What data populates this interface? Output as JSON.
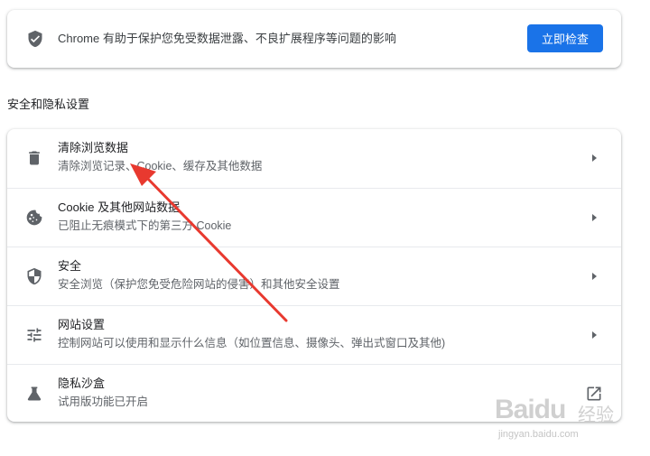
{
  "safety_check": {
    "icon": "shield-check-icon",
    "message": "Chrome 有助于保护您免受数据泄露、不良扩展程序等问题的影响",
    "button_label": "立即检查"
  },
  "privacy_section": {
    "title": "安全和隐私设置",
    "items": [
      {
        "icon": "trash-icon",
        "title": "清除浏览数据",
        "subtitle": "清除浏览记录、Cookie、缓存及其他数据",
        "action": "chevron-right-icon"
      },
      {
        "icon": "cookie-icon",
        "title": "Cookie 及其他网站数据",
        "subtitle": "已阻止无痕模式下的第三方 Cookie",
        "action": "chevron-right-icon"
      },
      {
        "icon": "shield-icon",
        "title": "安全",
        "subtitle": "安全浏览（保护您免受危险网站的侵害）和其他安全设置",
        "action": "chevron-right-icon"
      },
      {
        "icon": "tune-icon",
        "title": "网站设置",
        "subtitle": "控制网站可以使用和显示什么信息（如位置信息、摄像头、弹出式窗口及其他)",
        "action": "chevron-right-icon"
      },
      {
        "icon": "flask-icon",
        "title": "隐私沙盒",
        "subtitle": "试用版功能已开启",
        "action": "external-link-icon"
      }
    ]
  },
  "annotation": {
    "color": "#e8392f"
  },
  "watermark": {
    "logo": "Baidu",
    "cn": "经验",
    "url": "jingyan.baidu.com"
  }
}
